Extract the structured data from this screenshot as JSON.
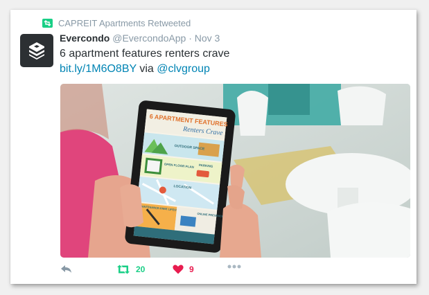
{
  "retweet_context": {
    "text": "CAPREIT Apartments Retweeted",
    "icon": "retweet-badge-icon"
  },
  "tweet": {
    "author_name": "Evercondo",
    "author_handle": "@EvercondoApp",
    "separator": "·",
    "date": "Nov 3",
    "text_line1": "6 apartment features renters crave",
    "link": "bit.ly/1M6O8BY",
    "via_word": "via",
    "mention": "@clvgroup"
  },
  "media": {
    "infographic": {
      "title_top": "6 APARTMENT FEATURES",
      "title_bottom": "Renters Crave",
      "sections": [
        "OUTDOOR SPACE",
        "OPEN FLOOR PLAN",
        "PARKING",
        "LOCATION",
        "MAINTENANCE-FREE LIFESTYLE",
        "ONLINE PRESENCE"
      ]
    }
  },
  "actions": {
    "retweet_count": "20",
    "like_count": "9"
  },
  "colors": {
    "retweet_green": "#19cf86",
    "like_red": "#e81c4f",
    "link_blue": "#0084b4",
    "muted_gray": "#8899a6"
  }
}
